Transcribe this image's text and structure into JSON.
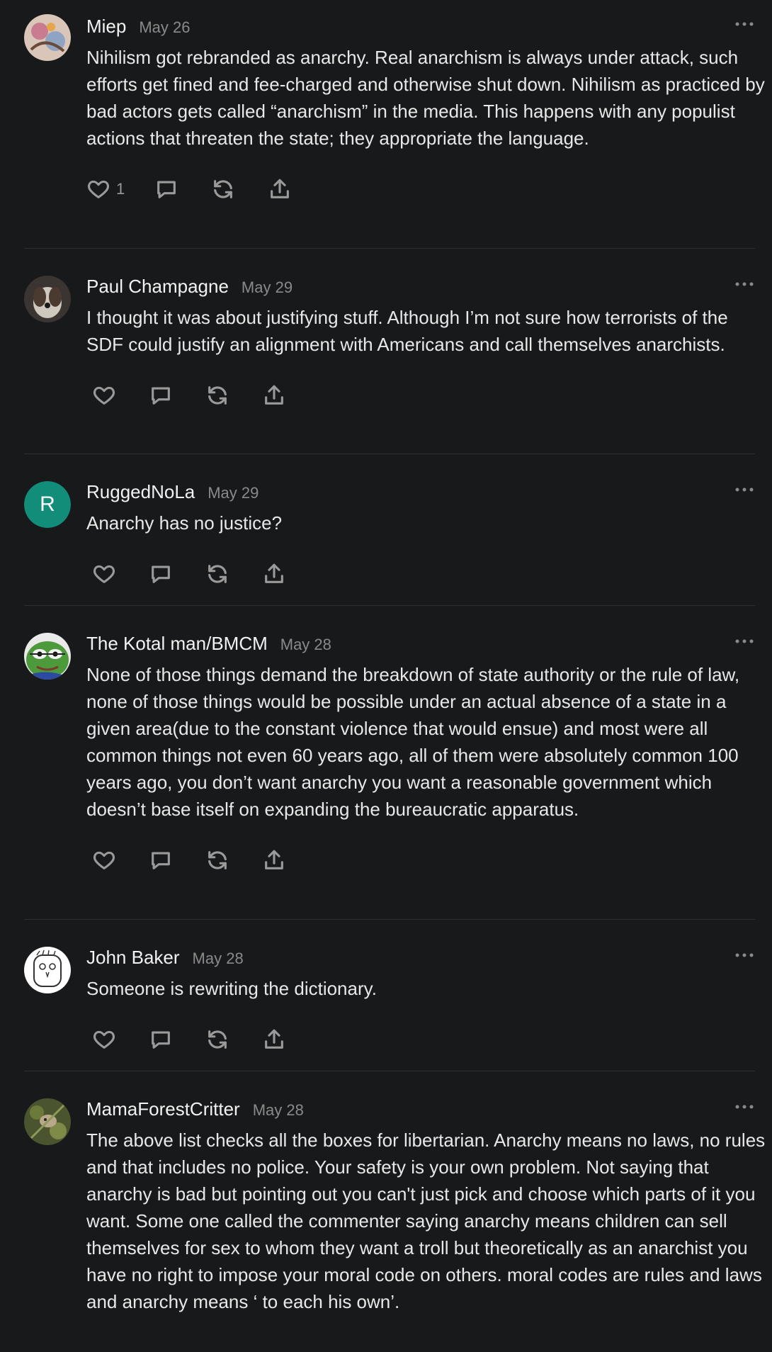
{
  "comments": [
    {
      "author": "Miep",
      "date": "May 26",
      "text": "Nihilism got rebranded as anarchy. Real anarchism is always under attack, such efforts get fined and fee-charged and otherwise shut down. Nihilism as practiced by bad actors gets called “anarchism” in the media. This happens with any populist actions that threaten the state; they appropriate the language.",
      "likes": "1",
      "avatar": "artwork-avatar"
    },
    {
      "author": "Paul Champagne",
      "date": "May 29",
      "text": "I thought it was about justifying stuff. Although I’m not sure how terrorists of the SDF could justify an alignment with Americans and call themselves anarchists.",
      "likes": "",
      "avatar": "dog-photo-avatar"
    },
    {
      "author": "RuggedNoLa",
      "date": "May 29",
      "text": "Anarchy has no justice?",
      "likes": "",
      "avatar_letter": "R",
      "avatar_color": "#118d7a"
    },
    {
      "author": "The Kotal man/BMCM",
      "date": "May 28",
      "text": "None of those things demand the breakdown of state authority or the rule of law, none of those things would be possible under an actual absence of a state in a given area(due to the constant violence that would ensue) and most were all common things not even 60 years ago, all of them were absolutely common 100 years ago, you don’t want anarchy you want a reasonable government which doesn’t base itself on expanding the bureaucratic apparatus.",
      "likes": "",
      "avatar": "frog-avatar"
    },
    {
      "author": "John Baker",
      "date": "May 28",
      "text": "Someone is rewriting the dictionary.",
      "likes": "",
      "avatar": "sketch-face-avatar"
    },
    {
      "author": "MamaForestCritter",
      "date": "May 28",
      "text": "The above list checks all the boxes for libertarian. Anarchy means no laws, no rules and that includes no police. Your safety is your own problem. Not saying that anarchy is bad but pointing out you can't just pick and choose which parts of it you want. Some one called the commenter saying anarchy means children can sell themselves for sex to whom they want a troll but theoretically as an anarchist you have no right to impose your moral code on others. moral codes are rules and laws and anarchy means ‘ to each his own’.",
      "likes": "",
      "avatar": "forest-photo-avatar"
    }
  ],
  "icons": {
    "like": "heart-icon",
    "reply": "comment-bubble-icon",
    "restack": "restack-icon",
    "share": "share-icon",
    "more": "more-dots-icon"
  }
}
